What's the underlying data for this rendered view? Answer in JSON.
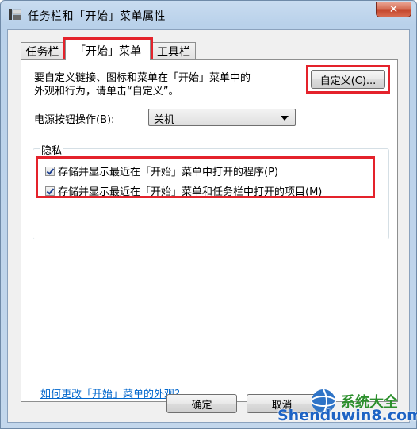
{
  "window": {
    "title": "任务栏和「开始」菜单属性",
    "close_symbol": "✕"
  },
  "tabs": [
    {
      "label": "任务栏"
    },
    {
      "label": "「开始」菜单"
    },
    {
      "label": "工具栏"
    }
  ],
  "start_menu": {
    "description_line1": "要自定义链接、图标和菜单在「开始」菜单中的",
    "description_line2": "外观和行为，请单击“自定义”。",
    "customize_button": "自定义(C)...",
    "power_label": "电源按钮操作(B):",
    "power_value": "关机",
    "privacy_title": "隐私",
    "privacy_options": [
      {
        "label": "存储并显示最近在「开始」菜单中打开的程序(P)",
        "checked": true
      },
      {
        "label": "存储并显示最近在「开始」菜单和任务栏中打开的项目(M)",
        "checked": true
      }
    ],
    "help_link": "如何更改「开始」菜单的外观?"
  },
  "footer": {
    "ok_button": "确定",
    "cancel_button": "取消"
  },
  "watermark": {
    "text": "Shenduwin8.com",
    "cn_text": "系统大全"
  },
  "colors": {
    "highlight": "#e4222b",
    "link": "#0066cc",
    "titlebar": "#b9d1ea"
  }
}
